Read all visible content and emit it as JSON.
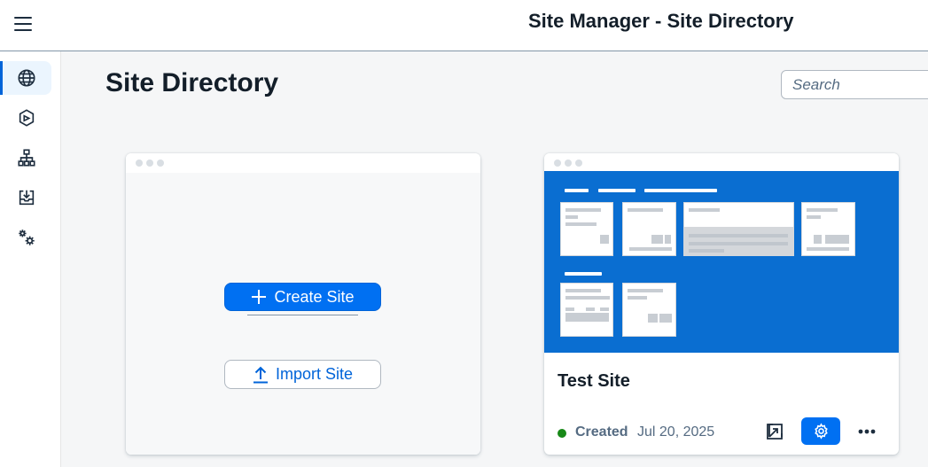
{
  "shell": {
    "title": "Site Manager - Site Directory"
  },
  "sidenav": {
    "items": [
      {
        "icon": "globe-icon",
        "label": "Site Directory",
        "active": true
      },
      {
        "icon": "content-icon",
        "label": "Content Manager",
        "active": false
      },
      {
        "icon": "hierarchy-icon",
        "label": "Provider Manager",
        "active": false
      },
      {
        "icon": "inbox-icon",
        "label": "Content Import",
        "active": false
      },
      {
        "icon": "settings-icon",
        "label": "Settings",
        "active": false
      }
    ]
  },
  "page": {
    "title": "Site Directory",
    "search_placeholder": "Search"
  },
  "create_card": {
    "create_label": "Create Site",
    "import_label": "Import Site"
  },
  "sites": [
    {
      "name": "Test Site",
      "status": "Created",
      "date": "Jul 20, 2025",
      "status_color": "#188918"
    }
  ],
  "colors": {
    "accent": "#0070f2",
    "preview_bg": "#0a6ed1"
  }
}
